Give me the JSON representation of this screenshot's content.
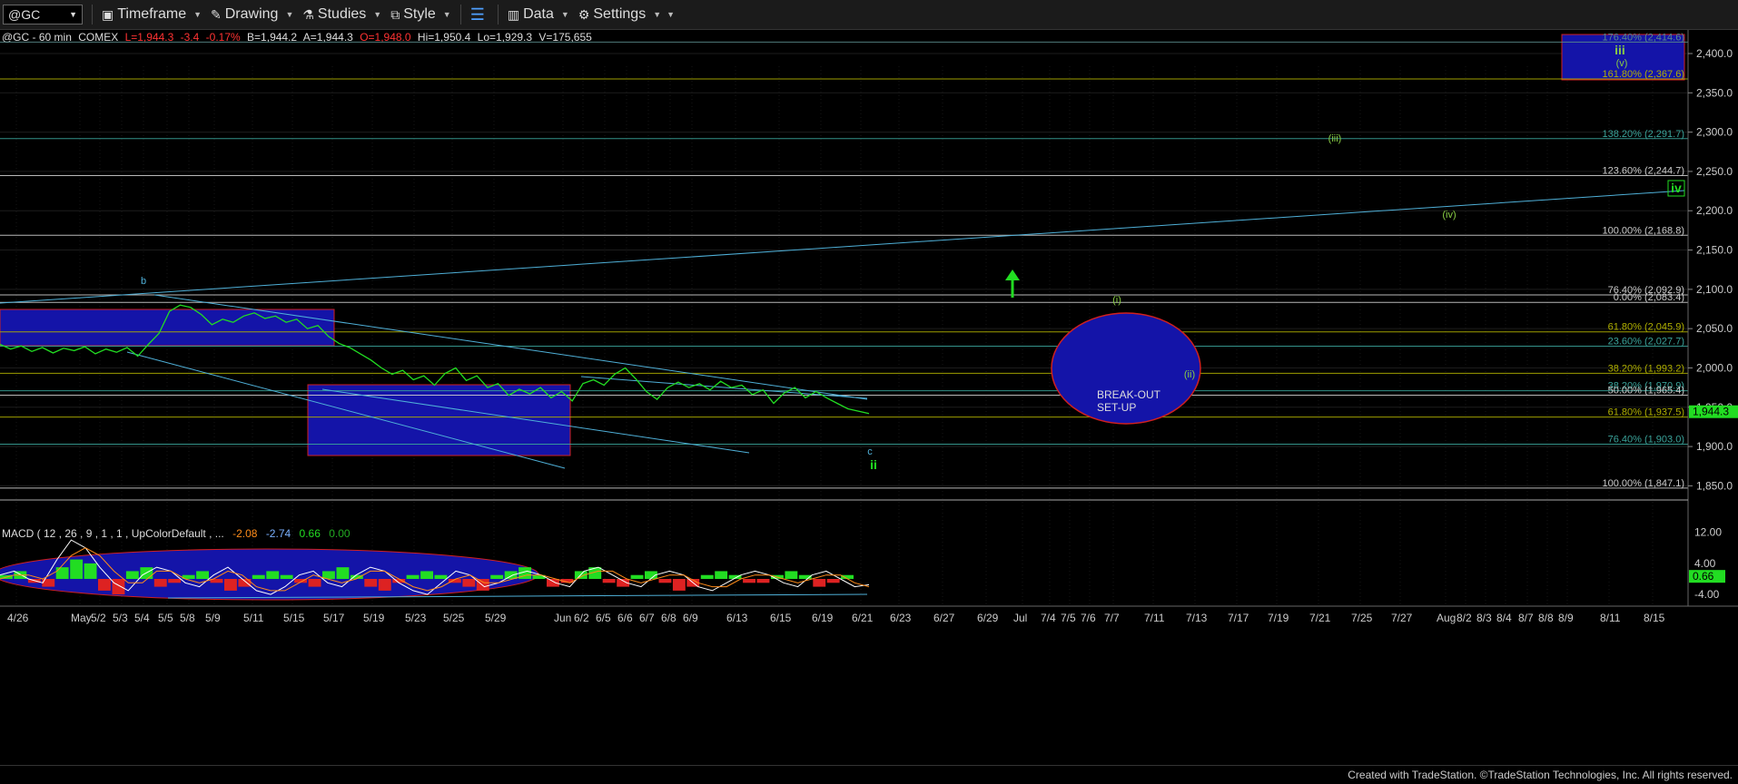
{
  "toolbar": {
    "symbol": "@GC",
    "timeframe": "Timeframe",
    "drawing": "Drawing",
    "studies": "Studies",
    "style": "Style",
    "data": "Data",
    "settings": "Settings"
  },
  "header": {
    "name": "@GC - 60 min",
    "exchange": "COMEX",
    "last": "L=1,944.3",
    "change": "-3.4",
    "pct": "-0.17%",
    "bid": "B=1,944.2",
    "ask": "A=1,944.3",
    "open": "O=1,948.0",
    "high": "Hi=1,950.4",
    "low": "Lo=1,929.3",
    "volume": "V=175,655"
  },
  "chart_data": {
    "type": "line",
    "ylim": [
      1832,
      2430
    ],
    "price_ticks": [
      "2,400.0",
      "2,350.0",
      "2,300.0",
      "2,250.0",
      "2,200.0",
      "2,150.0",
      "2,100.0",
      "2,050.0",
      "2,000.0",
      "1,950.0",
      "1,900.0",
      "1,850.0"
    ],
    "price_tick_values": [
      2400,
      2350,
      2300,
      2250,
      2200,
      2150,
      2100,
      2050,
      2000,
      1950,
      1900,
      1850
    ],
    "last_price_label": "1,944.3",
    "last_price": 1944.3,
    "date_labels": [
      "4/26",
      "May",
      "5/2",
      "5/3",
      "5/4",
      "5/5",
      "5/8",
      "5/9",
      "5/11",
      "5/15",
      "5/17",
      "5/19",
      "5/23",
      "5/25",
      "5/29",
      "Jun",
      "6/2",
      "6/5",
      "6/6",
      "6/7",
      "6/8",
      "6/9",
      "6/13",
      "6/15",
      "6/19",
      "6/21",
      "6/23",
      "6/27",
      "6/29",
      "Jul",
      "7/4",
      "7/5",
      "7/6",
      "7/7",
      "7/11",
      "7/13",
      "7/17",
      "7/19",
      "7/21",
      "7/25",
      "7/27",
      "Aug",
      "8/2",
      "8/3",
      "8/4",
      "8/7",
      "8/8",
      "8/9",
      "8/11",
      "8/15"
    ],
    "fib_levels": [
      {
        "label": "176.40% (2,414.6)",
        "value": 2414.6,
        "color": "#5a8a8a"
      },
      {
        "label": "161.80% (2,367.6)",
        "value": 2367.6,
        "color": "#b0b000"
      },
      {
        "label": "138.20% (2,291.7)",
        "value": 2291.7,
        "color": "#3aa39a"
      },
      {
        "label": "123.60% (2,244.7)",
        "value": 2244.7,
        "color": "#cccccc"
      },
      {
        "label": "100.00% (2,168.8)",
        "value": 2168.8,
        "color": "#cccccc"
      },
      {
        "label": "76.40% (2,092.9)",
        "value": 2092.9,
        "color": "#cccccc"
      },
      {
        "label": "0.00% (2,083.4)",
        "value": 2083.4,
        "color": "#cccccc"
      },
      {
        "label": "61.80% (2,045.9)",
        "value": 2045.9,
        "color": "#b0b000"
      },
      {
        "label": "23.60% (2,027.7)",
        "value": 2027.7,
        "color": "#3aa39a"
      },
      {
        "label": "38.20% (1,993.2)",
        "value": 1993.2,
        "color": "#b0b000"
      },
      {
        "label": "38.20% (1,970.9)",
        "value": 1970.9,
        "color": "#3aa39a"
      },
      {
        "label": "50.00% (1,965.4)",
        "value": 1965.4,
        "color": "#cccccc"
      },
      {
        "label": "61.80% (1,937.5)",
        "value": 1937.5,
        "color": "#b0b000"
      },
      {
        "label": "76.40% (1,903.0)",
        "value": 1903.0,
        "color": "#3aa39a"
      },
      {
        "label": "100.00% (1,847.1)",
        "value": 1847.1,
        "color": "#cccccc"
      }
    ],
    "wave_labels": [
      {
        "text": "b",
        "color": "#4fb0d8"
      },
      {
        "text": "c",
        "color": "#4fb0d8"
      },
      {
        "text": "ii",
        "color": "#22dd22"
      },
      {
        "text": "(i)",
        "color": "#88cc44"
      },
      {
        "text": "(ii)",
        "color": "#88cc44"
      },
      {
        "text": "(iii)",
        "color": "#88cc44"
      },
      {
        "text": "(iv)",
        "color": "#88cc44"
      },
      {
        "text": "(v)",
        "color": "#88cc44"
      },
      {
        "text": "iii",
        "color": "#88cc44"
      },
      {
        "text": "iv",
        "color": "#22dd22"
      }
    ],
    "annotation": "BREAK-OUT\nSET-UP",
    "price_series": [
      2030,
      2024,
      2028,
      2021,
      2026,
      2019,
      2025,
      2022,
      2027,
      2018,
      2024,
      2020,
      2026,
      2015,
      2030,
      2044,
      2072,
      2080,
      2077,
      2068,
      2055,
      2062,
      2058,
      2066,
      2070,
      2063,
      2066,
      2058,
      2062,
      2050,
      2054,
      2040,
      2031,
      2026,
      2018,
      2010,
      2000,
      1992,
      1997,
      1985,
      1990,
      1978,
      1993,
      2000,
      1984,
      1990,
      1975,
      1980,
      1965,
      1973,
      1967,
      1975,
      1962,
      1970,
      1958,
      1980,
      1985,
      1978,
      1992,
      2000,
      1986,
      1970,
      1960,
      1975,
      1982,
      1975,
      1980,
      1972,
      1983,
      1975,
      1978,
      1966,
      1972,
      1955,
      1968,
      1975,
      1962,
      1970,
      1962,
      1955,
      1948,
      1945,
      1942
    ],
    "macd": {
      "label": "MACD ( 12 , 26 , 9 , 1 , 1 , UpColorDefault , ...",
      "values": [
        "-2.08",
        "-2.74",
        "0.66",
        "0.00"
      ],
      "value_colors": [
        "#ff8c1a",
        "#7ab0ff",
        "#22dd22",
        "#22aa22"
      ],
      "ylim": [
        -7,
        14
      ],
      "ticks": [
        "12.00",
        "4.00",
        "-4.00"
      ],
      "tick_values": [
        12,
        4,
        -4
      ],
      "current_label": "0.66",
      "current": 0.66,
      "histogram": [
        1,
        2,
        -1,
        -2,
        3,
        5,
        4,
        -3,
        -4,
        2,
        3,
        -2,
        -1,
        1,
        2,
        -1,
        -3,
        -2,
        1,
        2,
        1,
        -1,
        -2,
        2,
        3,
        1,
        -2,
        -3,
        -1,
        1,
        2,
        1,
        -1,
        -2,
        -3,
        1,
        2,
        3,
        1,
        -2,
        -1,
        2,
        3,
        -1,
        -2,
        1,
        2,
        -1,
        -3,
        -2,
        1,
        2,
        1,
        -1,
        -1,
        1,
        2,
        1,
        -2,
        -1,
        1,
        0
      ],
      "macd_line": [
        1,
        2,
        0,
        -1,
        5,
        10,
        8,
        3,
        -1,
        -3,
        1,
        3,
        2,
        -1,
        -2,
        1,
        3,
        0,
        -3,
        -4,
        -2,
        1,
        2,
        -1,
        -2,
        1,
        3,
        2,
        -1,
        -3,
        -4,
        -1,
        2,
        1,
        -2,
        -1,
        1,
        2,
        1,
        -1,
        -2,
        2,
        3,
        1,
        -1,
        -2,
        1,
        2,
        1,
        -2,
        -3,
        -1,
        1,
        2,
        1,
        -1,
        -2,
        1,
        2,
        0,
        -2,
        -1.5
      ],
      "signal_line": [
        0,
        1,
        1,
        0,
        2,
        6,
        8,
        6,
        2,
        -1,
        -1,
        2,
        2,
        0,
        -1,
        0,
        2,
        1,
        -2,
        -3,
        -3,
        -1,
        1,
        0,
        -1,
        0,
        2,
        2,
        0,
        -2,
        -3,
        -2,
        0,
        1,
        -1,
        -1,
        0,
        1,
        1,
        0,
        -1,
        1,
        2,
        2,
        0,
        -1,
        0,
        1,
        1,
        -1,
        -2,
        -2,
        0,
        1,
        1,
        0,
        -1,
        0,
        1,
        1,
        -1,
        -2
      ]
    }
  },
  "footer": {
    "credit": "Created with TradeStation. ©TradeStation Technologies, Inc. All rights reserved."
  },
  "colors": {
    "price": "#22dd22",
    "channel": "#4fb0d8",
    "box_fill": "#1414a8",
    "ellipse_stroke": "#d02020",
    "arrow": "#22dd22"
  }
}
